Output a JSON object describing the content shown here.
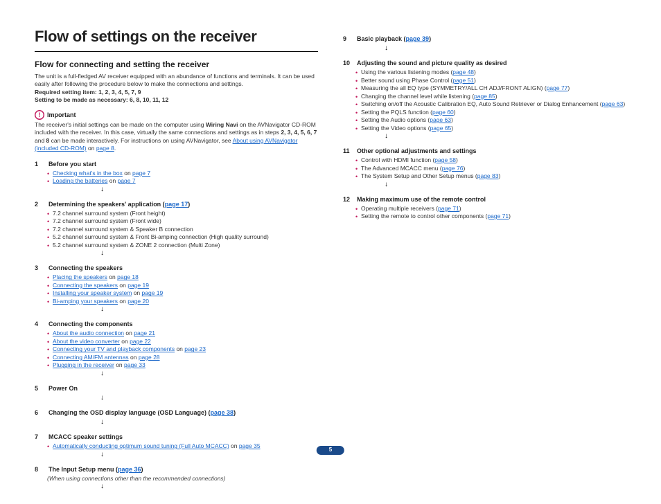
{
  "page_number": "5",
  "title": "Flow of settings on the receiver",
  "subtitle": "Flow for connecting and setting the receiver",
  "intro": "The unit is a full-fledged AV receiver equipped with an abundance of functions and terminals. It can be used easily after following the procedure below to make the connections and settings.",
  "reqline_label": "Required setting item",
  "reqline_vals": ": 1, 2, 3, 4, 5, 7, 9",
  "necline_label": "Setting to be made as necessary",
  "necline_vals": ": 6, 8, 10, 11, 12",
  "important_label": "Important",
  "important_p1": "The receiver's initial settings can be made on the computer using ",
  "important_wn": "Wiring Navi",
  "important_p2": " on the AVNavigator CD-ROM included with the receiver. In this case, virtually the same connections and settings as in steps ",
  "important_steps": "2, 3, 4, 5, 6, 7",
  "important_p3": " and ",
  "important_step8": "8",
  "important_p4": " can be made interactively. For instructions on using AVNavigator, see ",
  "important_link": "About using AVNavigator (included CD-ROM)",
  "important_p5": " on ",
  "important_pg": "page 8",
  "sections_left": [
    {
      "num": "1",
      "title": "Before you start",
      "items": [
        {
          "pre": "",
          "link": "Checking what's in the box",
          "post": " on ",
          "pg": "page 7"
        },
        {
          "pre": "",
          "link": "Loading the batteries",
          "post": " on ",
          "pg": "page 7"
        }
      ],
      "arrow": true
    },
    {
      "num": "2",
      "title_pre": "Determining the speakers' application (",
      "title_link": "page 17",
      "title_post": ")",
      "items": [
        {
          "text": "7.2 channel surround system (Front height)"
        },
        {
          "text": "7.2 channel surround system (Front wide)"
        },
        {
          "text": "7.2 channel surround system & Speaker B connection"
        },
        {
          "text": "5.2 channel surround system & Front Bi-amping connection (High quality surround)"
        },
        {
          "text": "5.2 channel surround system & ZONE 2 connection (Multi Zone)"
        }
      ],
      "arrow": true
    },
    {
      "num": "3",
      "title": "Connecting the speakers",
      "items": [
        {
          "pre": "",
          "link": "Placing the speakers",
          "post": " on ",
          "pg": "page 18"
        },
        {
          "pre": "",
          "link": "Connecting the speakers",
          "post": " on ",
          "pg": "page 19"
        },
        {
          "pre": "",
          "link": "Installing your speaker system",
          "post": " on ",
          "pg": "page 19"
        },
        {
          "pre": "",
          "link": "Bi-amping your speakers",
          "post": " on ",
          "pg": "page 20"
        }
      ],
      "arrow": true
    },
    {
      "num": "4",
      "title": "Connecting the components",
      "items": [
        {
          "pre": "",
          "link": "About the audio connection",
          "post": " on ",
          "pg": "page 21"
        },
        {
          "pre": "",
          "link": "About the video converter",
          "post": " on ",
          "pg": "page 22"
        },
        {
          "pre": "",
          "link": "Connecting your TV and playback components",
          "post": " on ",
          "pg": "page 23"
        },
        {
          "pre": "",
          "link": "Connecting AM/FM antennas",
          "post": " on ",
          "pg": "page 28"
        },
        {
          "pre": "",
          "link": "Plugging in the receiver",
          "post": " on ",
          "pg": "page 33"
        }
      ],
      "arrow": true
    },
    {
      "num": "5",
      "title": "Power On",
      "items": [],
      "arrow": true
    },
    {
      "num": "6",
      "title_pre": "Changing the OSD display language (OSD Language) (",
      "title_link": "page 38",
      "title_post": ")",
      "items": [],
      "arrow": true
    },
    {
      "num": "7",
      "title": "MCACC speaker settings",
      "items": [
        {
          "pre": "",
          "link": "Automatically conducting optimum sound tuning (Full Auto MCACC)",
          "post": " on ",
          "pg": "page 35"
        }
      ],
      "arrow": true
    },
    {
      "num": "8",
      "title_pre": "The Input Setup menu (",
      "title_link": "page 36",
      "title_post": ")",
      "note": "(When using connections other than the recommended connections)",
      "items": [],
      "arrow": true
    }
  ],
  "sections_right": [
    {
      "num": "9",
      "title_pre": "Basic playback (",
      "title_link": "page 39",
      "title_post": ")",
      "items": [],
      "arrow": true
    },
    {
      "num": "10",
      "title": "Adjusting the sound and picture quality as desired",
      "items": [
        {
          "pre": "Using the various listening modes (",
          "link": "page 48",
          "post": ")"
        },
        {
          "pre": "Better sound using Phase Control (",
          "link": "page 51",
          "post": ")"
        },
        {
          "pre": "Measuring the all EQ type (SYMMETRY/ALL CH ADJ/FRONT ALIGN) (",
          "link": "page 77",
          "post": ")"
        },
        {
          "pre": "Changing the channel level while listening (",
          "link": "page 85",
          "post": ")"
        },
        {
          "pre": "Switching on/off the Acoustic Calibration EQ, Auto Sound Retriever or Dialog Enhancement (",
          "link": "page 63",
          "post": ")"
        },
        {
          "pre": "Setting the PQLS function (",
          "link": "page 60",
          "post": ")"
        },
        {
          "pre": "Setting the Audio options (",
          "link": "page 63",
          "post": ")"
        },
        {
          "pre": "Setting the Video options (",
          "link": "page 65",
          "post": ")"
        }
      ],
      "arrow": true
    },
    {
      "num": "11",
      "title": "Other optional adjustments and settings",
      "items": [
        {
          "pre": "Control with HDMI function (",
          "link": "page 58",
          "post": ")"
        },
        {
          "pre": "The Advanced MCACC menu (",
          "link": "page 76",
          "post": ")"
        },
        {
          "pre": "The System Setup and Other Setup menus (",
          "link": "page 83",
          "post": ")"
        }
      ],
      "arrow": true
    },
    {
      "num": "12",
      "title": "Making maximum use of the remote control",
      "items": [
        {
          "pre": "Operating multiple receivers (",
          "link": "page 71",
          "post": ")"
        },
        {
          "pre": "Setting the remote to control other components (",
          "link": "page 71",
          "post": ")"
        }
      ],
      "arrow": false
    }
  ]
}
